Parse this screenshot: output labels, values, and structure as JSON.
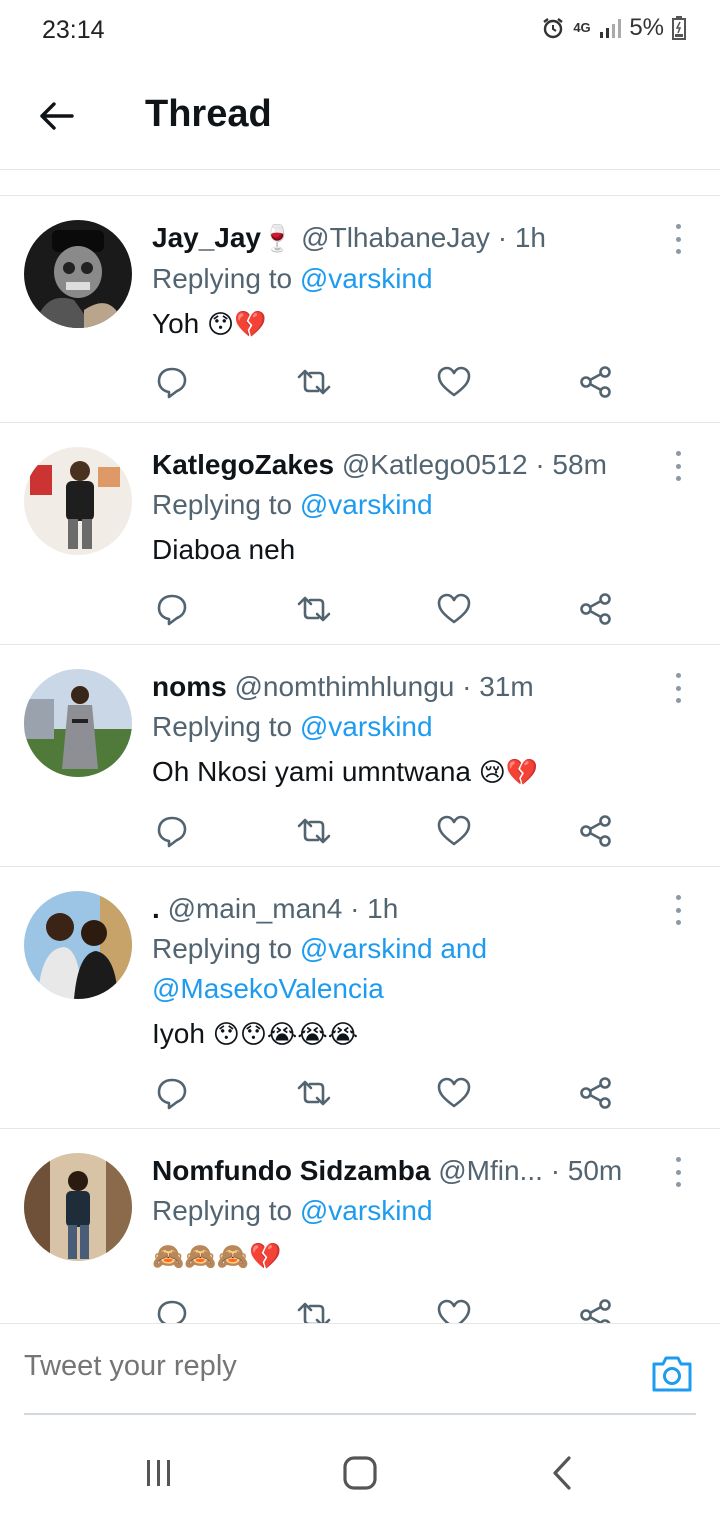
{
  "status": {
    "time": "23:14",
    "network": "4G",
    "battery": "5%"
  },
  "header": {
    "title": "Thread"
  },
  "tweets": [
    {
      "name": "Jay_Jay",
      "name_emoji": "🍷",
      "handle": "@TlhabaneJay",
      "time": "· 1h",
      "reply_prefix": "Replying to",
      "reply_to": "@varskind",
      "reply_to_2": "",
      "text": "Yoh",
      "emojis": "😯💔"
    },
    {
      "name": "KatlegoZakes",
      "name_emoji": "",
      "handle": "@Katlego0512",
      "time": "· 58m",
      "reply_prefix": "Replying to",
      "reply_to": "@varskind",
      "reply_to_2": "",
      "text": "Diaboa neh",
      "emojis": ""
    },
    {
      "name": "noms",
      "name_emoji": "",
      "handle": "@nomthimhlungu",
      "time": "· 31m",
      "reply_prefix": "Replying to",
      "reply_to": "@varskind",
      "reply_to_2": "",
      "text": "Oh Nkosi yami umntwana",
      "emojis": "😢💔"
    },
    {
      "name": ".",
      "name_emoji": "",
      "handle": "@main_man4",
      "time": "· 1h",
      "reply_prefix": "Replying to",
      "reply_to": "@varskind and",
      "reply_to_2": "@MasekoValencia",
      "text": "Iyoh",
      "emojis": "😯😯😭😭😭"
    },
    {
      "name": "Nomfundo Sidzamba",
      "name_emoji": "",
      "handle": "@Mfin...",
      "time": "· 50m",
      "reply_prefix": "Replying to",
      "reply_to": "@varskind",
      "reply_to_2": "",
      "text": "",
      "emojis": "🙈🙈🙈💔"
    }
  ],
  "composer": {
    "placeholder": "Tweet your reply"
  },
  "colors": {
    "accent": "#1d9bf0",
    "text": "#0f1419",
    "muted": "#536471",
    "divider": "#e6e6e6"
  },
  "icons": {
    "reply": "comment-icon",
    "retweet": "retweet-icon",
    "like": "heart-icon",
    "share": "share-icon"
  }
}
